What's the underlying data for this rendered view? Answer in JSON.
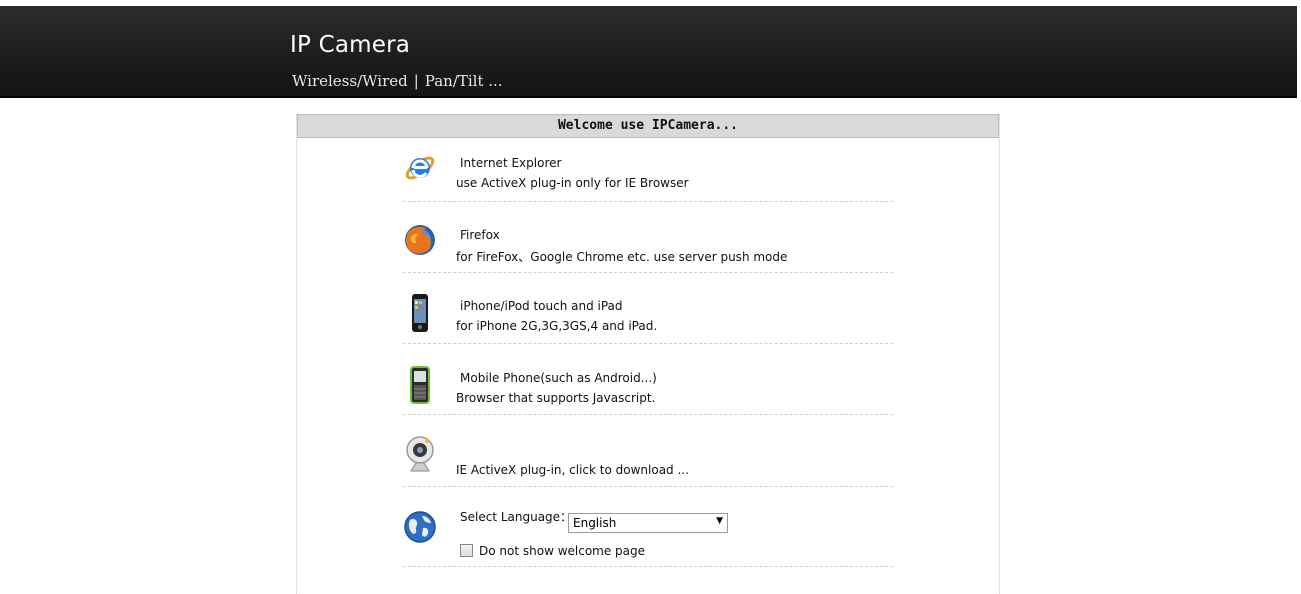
{
  "header": {
    "title": "IP Camera",
    "subtitle_left": "Wireless/Wired",
    "subtitle_sep": "|",
    "subtitle_right": "Pan/Tilt ..."
  },
  "panel": {
    "title": "Welcome use IPCamera..."
  },
  "options": [
    {
      "label": "Internet Explorer",
      "desc": "use ActiveX plug-in only for IE Browser",
      "icon": "internet-explorer-icon"
    },
    {
      "label": "Firefox",
      "desc": "for FireFox、Google Chrome etc. use server push mode",
      "icon": "firefox-icon"
    },
    {
      "label": "iPhone/iPod touch and iPad",
      "desc": "for iPhone 2G,3G,3GS,4 and iPad.",
      "icon": "iphone-icon"
    },
    {
      "label": "Mobile Phone(such as Android...)",
      "desc": "Browser that supports Javascript.",
      "icon": "mobile-phone-icon"
    }
  ],
  "download": {
    "label": "IE ActiveX plug-in, click to download ...",
    "icon": "webcam-icon"
  },
  "language": {
    "label": "Select Language：",
    "selected": "English",
    "icon": "globe-icon",
    "dont_show_label": "Do not show welcome page",
    "dont_show_checked": false
  }
}
